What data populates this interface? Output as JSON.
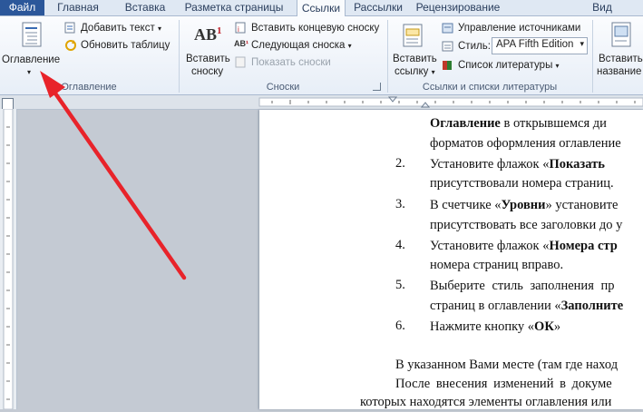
{
  "tabs": [
    "Файл",
    "Главная",
    "Вставка",
    "Разметка страницы",
    "Ссылки",
    "Рассылки",
    "Рецензирование",
    "Вид"
  ],
  "ribbon": {
    "toc_label": "Оглавление",
    "add_text": "Добавить текст",
    "update_table": "Обновить таблицу",
    "group_toc": "Оглавление",
    "insert_footnote_1": "Вставить",
    "insert_footnote_2": "сноску",
    "insert_endnote": "Вставить концевую сноску",
    "next_footnote": "Следующая сноска",
    "show_notes": "Показать сноски",
    "group_footnotes": "Сноски",
    "insert_citation_1": "Вставить",
    "insert_citation_2": "ссылку",
    "manage_sources": "Управление источниками",
    "style_label": "Стиль:",
    "style_value": "APA Fifth Edition",
    "bibliography": "Список литературы",
    "group_citations": "Ссылки и списки литературы",
    "insert_caption_1": "Вставить",
    "insert_caption_2": "название"
  },
  "doc": {
    "l1": [
      "Оглавление",
      " в открывшемся ди"
    ],
    "l2": "форматов оформления оглавление",
    "l3_pre": "Установите флажок «",
    "l3_bold": "Показать",
    "l4": "присутствовали номера страниц.",
    "l5_pre": "В счетчике «",
    "l5_bold": "Уровни",
    "l5_post": "» установите",
    "l6": "присутствовать все заголовки до у",
    "l7_pre": "Установите флажок «",
    "l7_bold": "Номера стр",
    "l8": "номера страниц вправо.",
    "l9": "Выберите  стиль  заполнения  пр",
    "l10_pre": "страниц в оглавлении «",
    "l10_bold": "Заполните",
    "l11_pre": "Нажмите кнопку «",
    "l11_bold": "ОК",
    "l11_post": "»",
    "p1": "В указанном Вами месте (там где наход",
    "p2": "После  внесения  изменений  в  докуме",
    "p3": "которых находятся элементы оглавления или",
    "nums": [
      "2.",
      "3.",
      "4.",
      "5.",
      "6."
    ]
  },
  "colors": {
    "file_tab": "#2b579a",
    "arrow": "#e8232a"
  }
}
